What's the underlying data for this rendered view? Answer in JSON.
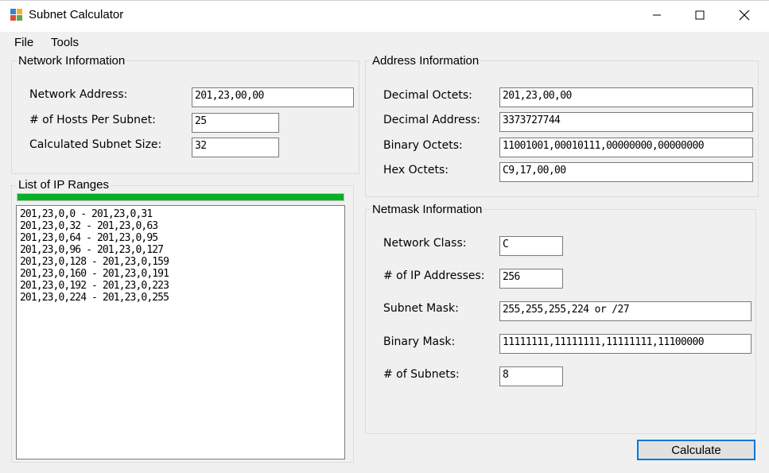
{
  "window": {
    "title": "Subnet Calculator"
  },
  "menu": {
    "items": [
      "File",
      "Tools"
    ]
  },
  "network_info": {
    "group_label": "Network Information",
    "network_address_label": "Network Address:",
    "network_address_value": "201,23,00,00",
    "hosts_label": "# of Hosts Per Subnet:",
    "hosts_value": "25",
    "subnet_size_label": "Calculated Subnet Size:",
    "subnet_size_value": "32"
  },
  "ip_ranges": {
    "group_label": "List of IP Ranges",
    "progress": 1.0,
    "progress_color": "#06b025",
    "items": [
      "201,23,0,0 - 201,23,0,31",
      "201,23,0,32 - 201,23,0,63",
      "201,23,0,64 - 201,23,0,95",
      "201,23,0,96 - 201,23,0,127",
      "201,23,0,128 - 201,23,0,159",
      "201,23,0,160 - 201,23,0,191",
      "201,23,0,192 - 201,23,0,223",
      "201,23,0,224 - 201,23,0,255"
    ]
  },
  "address_info": {
    "group_label": "Address Information",
    "decimal_octets_label": "Decimal Octets:",
    "decimal_octets_value": "201,23,00,00",
    "decimal_address_label": "Decimal Address:",
    "decimal_address_value": "3373727744",
    "binary_octets_label": "Binary Octets:",
    "binary_octets_value": "11001001,00010111,00000000,00000000",
    "hex_octets_label": "Hex Octets:",
    "hex_octets_value": "C9,17,00,00"
  },
  "netmask_info": {
    "group_label": "Netmask Information",
    "network_class_label": "Network Class:",
    "network_class_value": "C",
    "ip_addresses_label": "# of IP Addresses:",
    "ip_addresses_value": "256",
    "subnet_mask_label": "Subnet Mask:",
    "subnet_mask_value": "255,255,255,224 or /27",
    "binary_mask_label": "Binary Mask:",
    "binary_mask_value": "11111111,11111111,11111111,11100000",
    "subnets_label": "# of Subnets:",
    "subnets_value": "8"
  },
  "actions": {
    "calculate_label": "Calculate"
  }
}
